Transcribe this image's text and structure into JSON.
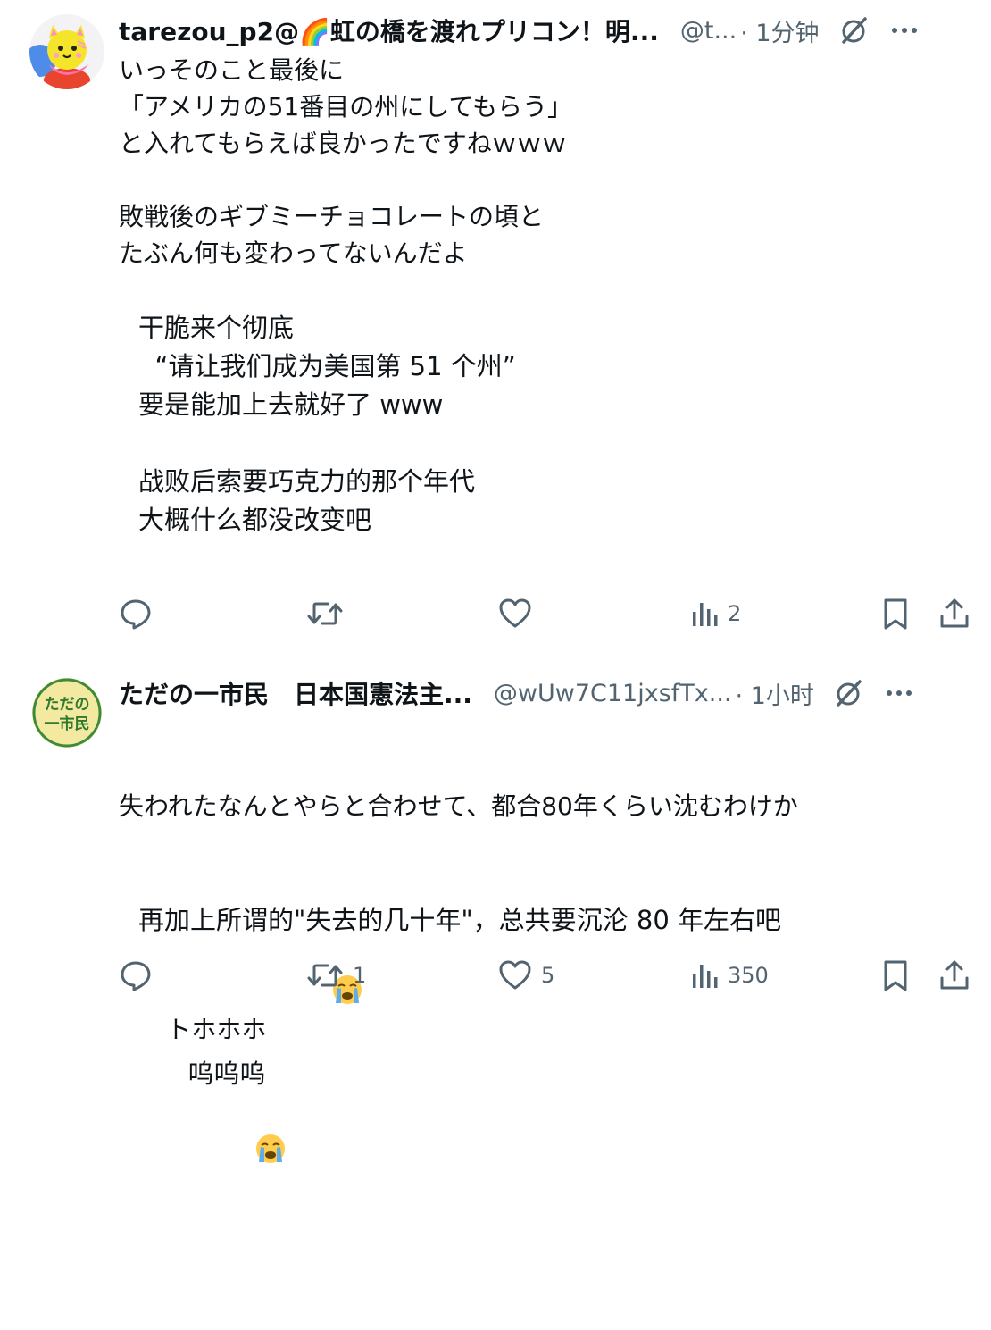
{
  "posts": [
    {
      "display_name": "tarezou_p2@🌈虹の橋を渡れプリコン！明...",
      "handle": "@t...",
      "time": "· 1分钟",
      "text": "いっそのこと最後に\n「アメリカの51番目の州にしてもらう」\nと入れてもらえば良かったですねｗｗｗ\n\n敗戦後のギブミーチョコレートの頃と\nたぶん何も変わってないんだよ",
      "translation": "干脆来个彻底\n  “请让我们成为美国第 51 个州”\n要是能加上去就好了 www\n\n战败后索要巧克力的那个年代\n大概什么都没改变吧",
      "actions": {
        "reply_count": "",
        "repost_count": "",
        "like_count": "",
        "views_count": "2"
      },
      "avatar_icon": "yellow-cat-avatar"
    },
    {
      "display_name": "ただの一市民　日本国憲法主...",
      "handle": "@wUw7C11jxsfTx...",
      "time": "· 1小时",
      "avatar_text": "ただの\n一市民",
      "text_line1": "失われたなんとやらと合わせて、都合80年くらい沈むわけか",
      "text_line2": "トホホホ",
      "translation_line1": "再加上所谓的\"失去的几十年\"，总共要沉沦 80 年左右吧",
      "translation_line2": "呜呜呜",
      "actions": {
        "reply_count": "",
        "repost_count": "1",
        "like_count": "5",
        "views_count": "350"
      }
    }
  ],
  "icons": {
    "grok": "grok-slash-icon",
    "more": "more-dots-icon",
    "reply": "reply-icon",
    "repost": "repost-icon",
    "like": "heart-icon",
    "views": "views-bar-chart-icon",
    "bookmark": "bookmark-icon",
    "share": "share-icon",
    "crying": "crying-face-emoji"
  },
  "colors": {
    "text": "#0f1419",
    "muted": "#536471",
    "avatar2_bg": "#f4e9a0",
    "avatar2_text": "#2f7a2f"
  }
}
